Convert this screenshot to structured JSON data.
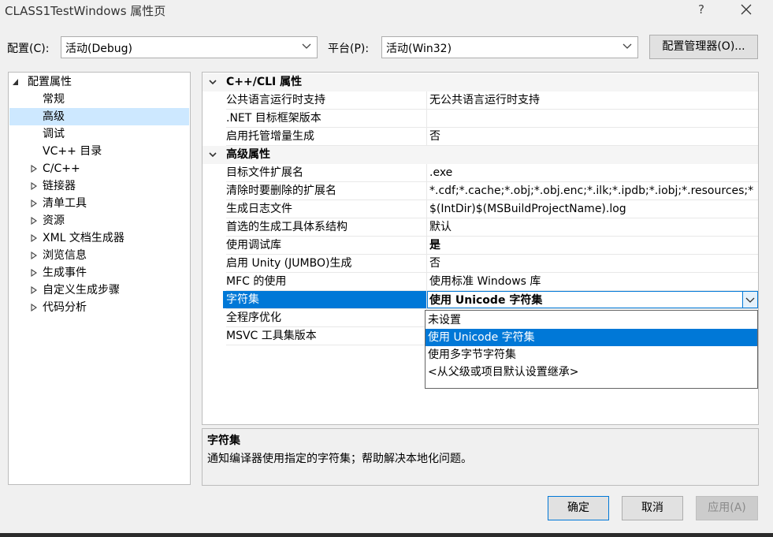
{
  "window": {
    "title": "CLASS1TestWindows 属性页",
    "help": "?",
    "close": "✕"
  },
  "toolbar": {
    "config_label": "配置(C):",
    "config_value": "活动(Debug)",
    "platform_label": "平台(P):",
    "platform_value": "活动(Win32)",
    "config_manager": "配置管理器(O)..."
  },
  "tree": {
    "root": "配置属性",
    "items": [
      {
        "label": "常规",
        "expandable": false,
        "selected": false
      },
      {
        "label": "高级",
        "expandable": false,
        "selected": true
      },
      {
        "label": "调试",
        "expandable": false,
        "selected": false
      },
      {
        "label": "VC++ 目录",
        "expandable": false,
        "selected": false
      },
      {
        "label": "C/C++",
        "expandable": true,
        "selected": false
      },
      {
        "label": "链接器",
        "expandable": true,
        "selected": false
      },
      {
        "label": "清单工具",
        "expandable": true,
        "selected": false
      },
      {
        "label": "资源",
        "expandable": true,
        "selected": false
      },
      {
        "label": "XML 文档生成器",
        "expandable": true,
        "selected": false
      },
      {
        "label": "浏览信息",
        "expandable": true,
        "selected": false
      },
      {
        "label": "生成事件",
        "expandable": true,
        "selected": false
      },
      {
        "label": "自定义生成步骤",
        "expandable": true,
        "selected": false
      },
      {
        "label": "代码分析",
        "expandable": true,
        "selected": false
      }
    ]
  },
  "grid": {
    "cat1": "C++/CLI 属性",
    "cat1_rows": [
      {
        "name": "公共语言运行时支持",
        "value": "无公共语言运行时支持"
      },
      {
        "name": ".NET 目标框架版本",
        "value": ""
      },
      {
        "name": "启用托管增量生成",
        "value": "否"
      }
    ],
    "cat2": "高级属性",
    "cat2_rows": [
      {
        "name": "目标文件扩展名",
        "value": ".exe"
      },
      {
        "name": "清除时要删除的扩展名",
        "value": "*.cdf;*.cache;*.obj;*.obj.enc;*.ilk;*.ipdb;*.iobj;*.resources;*"
      },
      {
        "name": "生成日志文件",
        "value": "$(IntDir)$(MSBuildProjectName).log"
      },
      {
        "name": "首选的生成工具体系结构",
        "value": "默认"
      },
      {
        "name": "使用调试库",
        "value": "是"
      },
      {
        "name": "启用 Unity (JUMBO)生成",
        "value": "否"
      },
      {
        "name": "MFC 的使用",
        "value": "使用标准 Windows 库"
      },
      {
        "name": "字符集",
        "value": "使用 Unicode 字符集"
      },
      {
        "name": "全程序优化",
        "value": ""
      },
      {
        "name": "MSVC 工具集版本",
        "value": ""
      }
    ]
  },
  "dropdown": {
    "options": [
      "未设置",
      "使用 Unicode 字符集",
      "使用多字节字符集",
      "<从父级或项目默认设置继承>"
    ],
    "selected_index": 1
  },
  "description": {
    "title": "字符集",
    "text": "通知编译器使用指定的字符集；帮助解决本地化问题。"
  },
  "buttons": {
    "ok": "确定",
    "cancel": "取消",
    "apply": "应用(A)"
  },
  "colors": {
    "selection": "#0078d7",
    "tree_selection": "#cde8ff",
    "dropdown_border": "#0078d7"
  }
}
